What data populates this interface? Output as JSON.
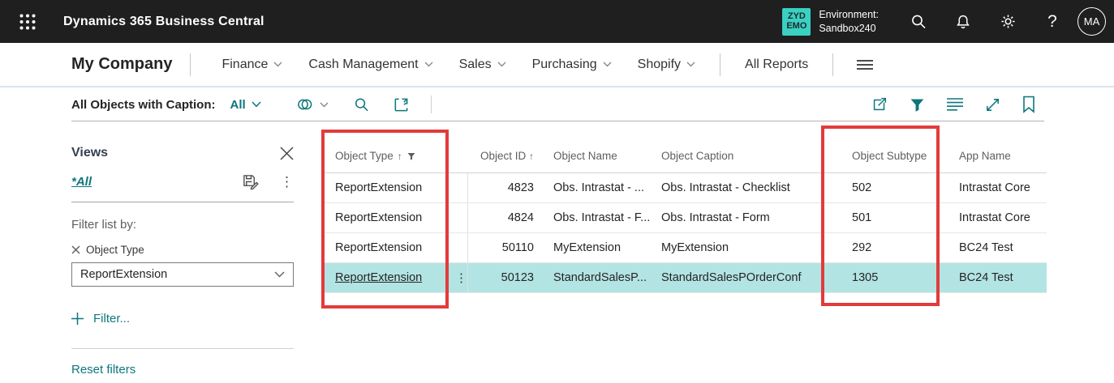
{
  "top_bar": {
    "app_title": "Dynamics 365 Business Central",
    "environment_badge": {
      "line1": "ZYD",
      "line2": "EMO"
    },
    "environment_label": "Environment:",
    "environment_name": "Sandbox240",
    "avatar_initials": "MA"
  },
  "nav": {
    "company": "My Company",
    "items": [
      {
        "label": "Finance"
      },
      {
        "label": "Cash Management"
      },
      {
        "label": "Sales"
      },
      {
        "label": "Purchasing"
      },
      {
        "label": "Shopify"
      }
    ],
    "all_reports": "All Reports"
  },
  "toolbar": {
    "caption": "All Objects with Caption:",
    "scope": "All"
  },
  "views_panel": {
    "title": "Views",
    "active_view": "*All",
    "filter_list_label": "Filter list by:",
    "filter_field": "Object Type",
    "filter_value": "ReportExtension",
    "add_filter_label": "Filter...",
    "reset_label": "Reset filters"
  },
  "table": {
    "columns": [
      "Object Type",
      "Object ID",
      "Object Name",
      "Object Caption",
      "Object Subtype",
      "App Name"
    ],
    "rows": [
      {
        "object_type": "ReportExtension",
        "object_id": "4823",
        "object_name": "Obs. Intrastat - ...",
        "object_caption": "Obs. Intrastat - Checklist",
        "object_subtype": "502",
        "app_name": "Intrastat Core"
      },
      {
        "object_type": "ReportExtension",
        "object_id": "4824",
        "object_name": "Obs. Intrastat - F...",
        "object_caption": "Obs. Intrastat - Form",
        "object_subtype": "501",
        "app_name": "Intrastat Core"
      },
      {
        "object_type": "ReportExtension",
        "object_id": "50110",
        "object_name": "MyExtension",
        "object_caption": "MyExtension",
        "object_subtype": "292",
        "app_name": "BC24 Test"
      },
      {
        "object_type": "ReportExtension",
        "object_id": "50123",
        "object_name": "StandardSalesP...",
        "object_caption": "StandardSalesPOrderConf",
        "object_subtype": "1305",
        "app_name": "BC24 Test"
      }
    ]
  },
  "colors": {
    "accent": "#0e767d",
    "environment_badge": "#3ad0c2",
    "selected_row": "#b3e4e4",
    "annotation": "#e23b3b",
    "topbar_background": "#1f1f1f"
  }
}
